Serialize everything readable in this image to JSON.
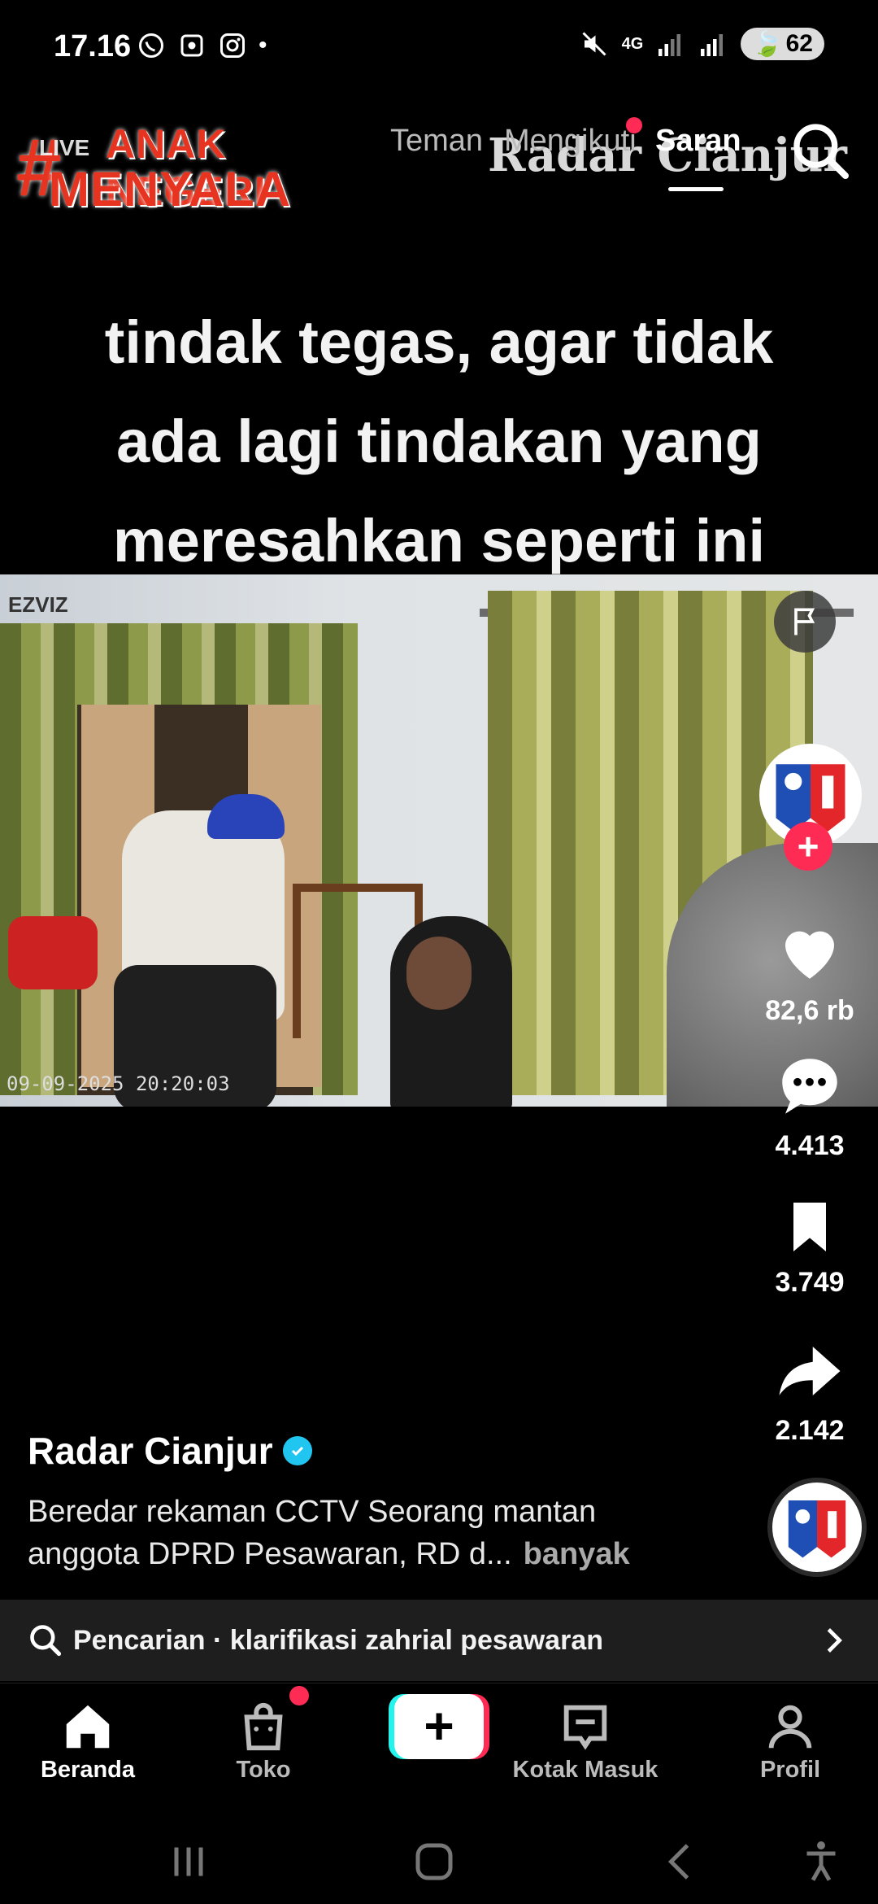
{
  "status": {
    "time": "17.16",
    "battery": "62",
    "network": "4G",
    "app_icons": [
      "whatsapp-icon",
      "screenshot-icon",
      "instagram-icon"
    ]
  },
  "top_nav": {
    "overlay_brand_line1": "ANAK NEGERI",
    "overlay_brand_line2": "MENYALA",
    "overlay_hash": "#",
    "live_label": "LIVE",
    "tabs": [
      "Teman",
      "Mengikuti",
      "Saran"
    ],
    "active_tab": "Saran",
    "watermark": "Radar Cianjur"
  },
  "video": {
    "caption_lines": [
      "tindak tegas, agar tidak",
      "ada lagi tindakan yang",
      "meresahkan seperti ini"
    ],
    "cam_brand": "EZVIZ",
    "cam_timestamp": "09-09-2025 20:20:03"
  },
  "rail": {
    "likes": "82,6 rb",
    "comments": "4.413",
    "bookmarks": "3.749",
    "shares": "2.142"
  },
  "post": {
    "author": "Radar Cianjur",
    "description_line1": "Beredar rekaman CCTV Seorang mantan",
    "description_line2": "anggota DPRD Pesawaran, RD d...",
    "more_label": "banyak"
  },
  "search_suggestion": {
    "prefix": "Pencarian",
    "separator": " · ",
    "query": "klarifikasi zahrial pesawaran"
  },
  "bottom_nav": {
    "home": "Beranda",
    "shop": "Toko",
    "create": "+",
    "inbox": "Kotak Masuk",
    "profile": "Profil"
  },
  "colors": {
    "accent": "#fe2c55",
    "cyan": "#25f4ee",
    "verified": "#20c5f0"
  }
}
